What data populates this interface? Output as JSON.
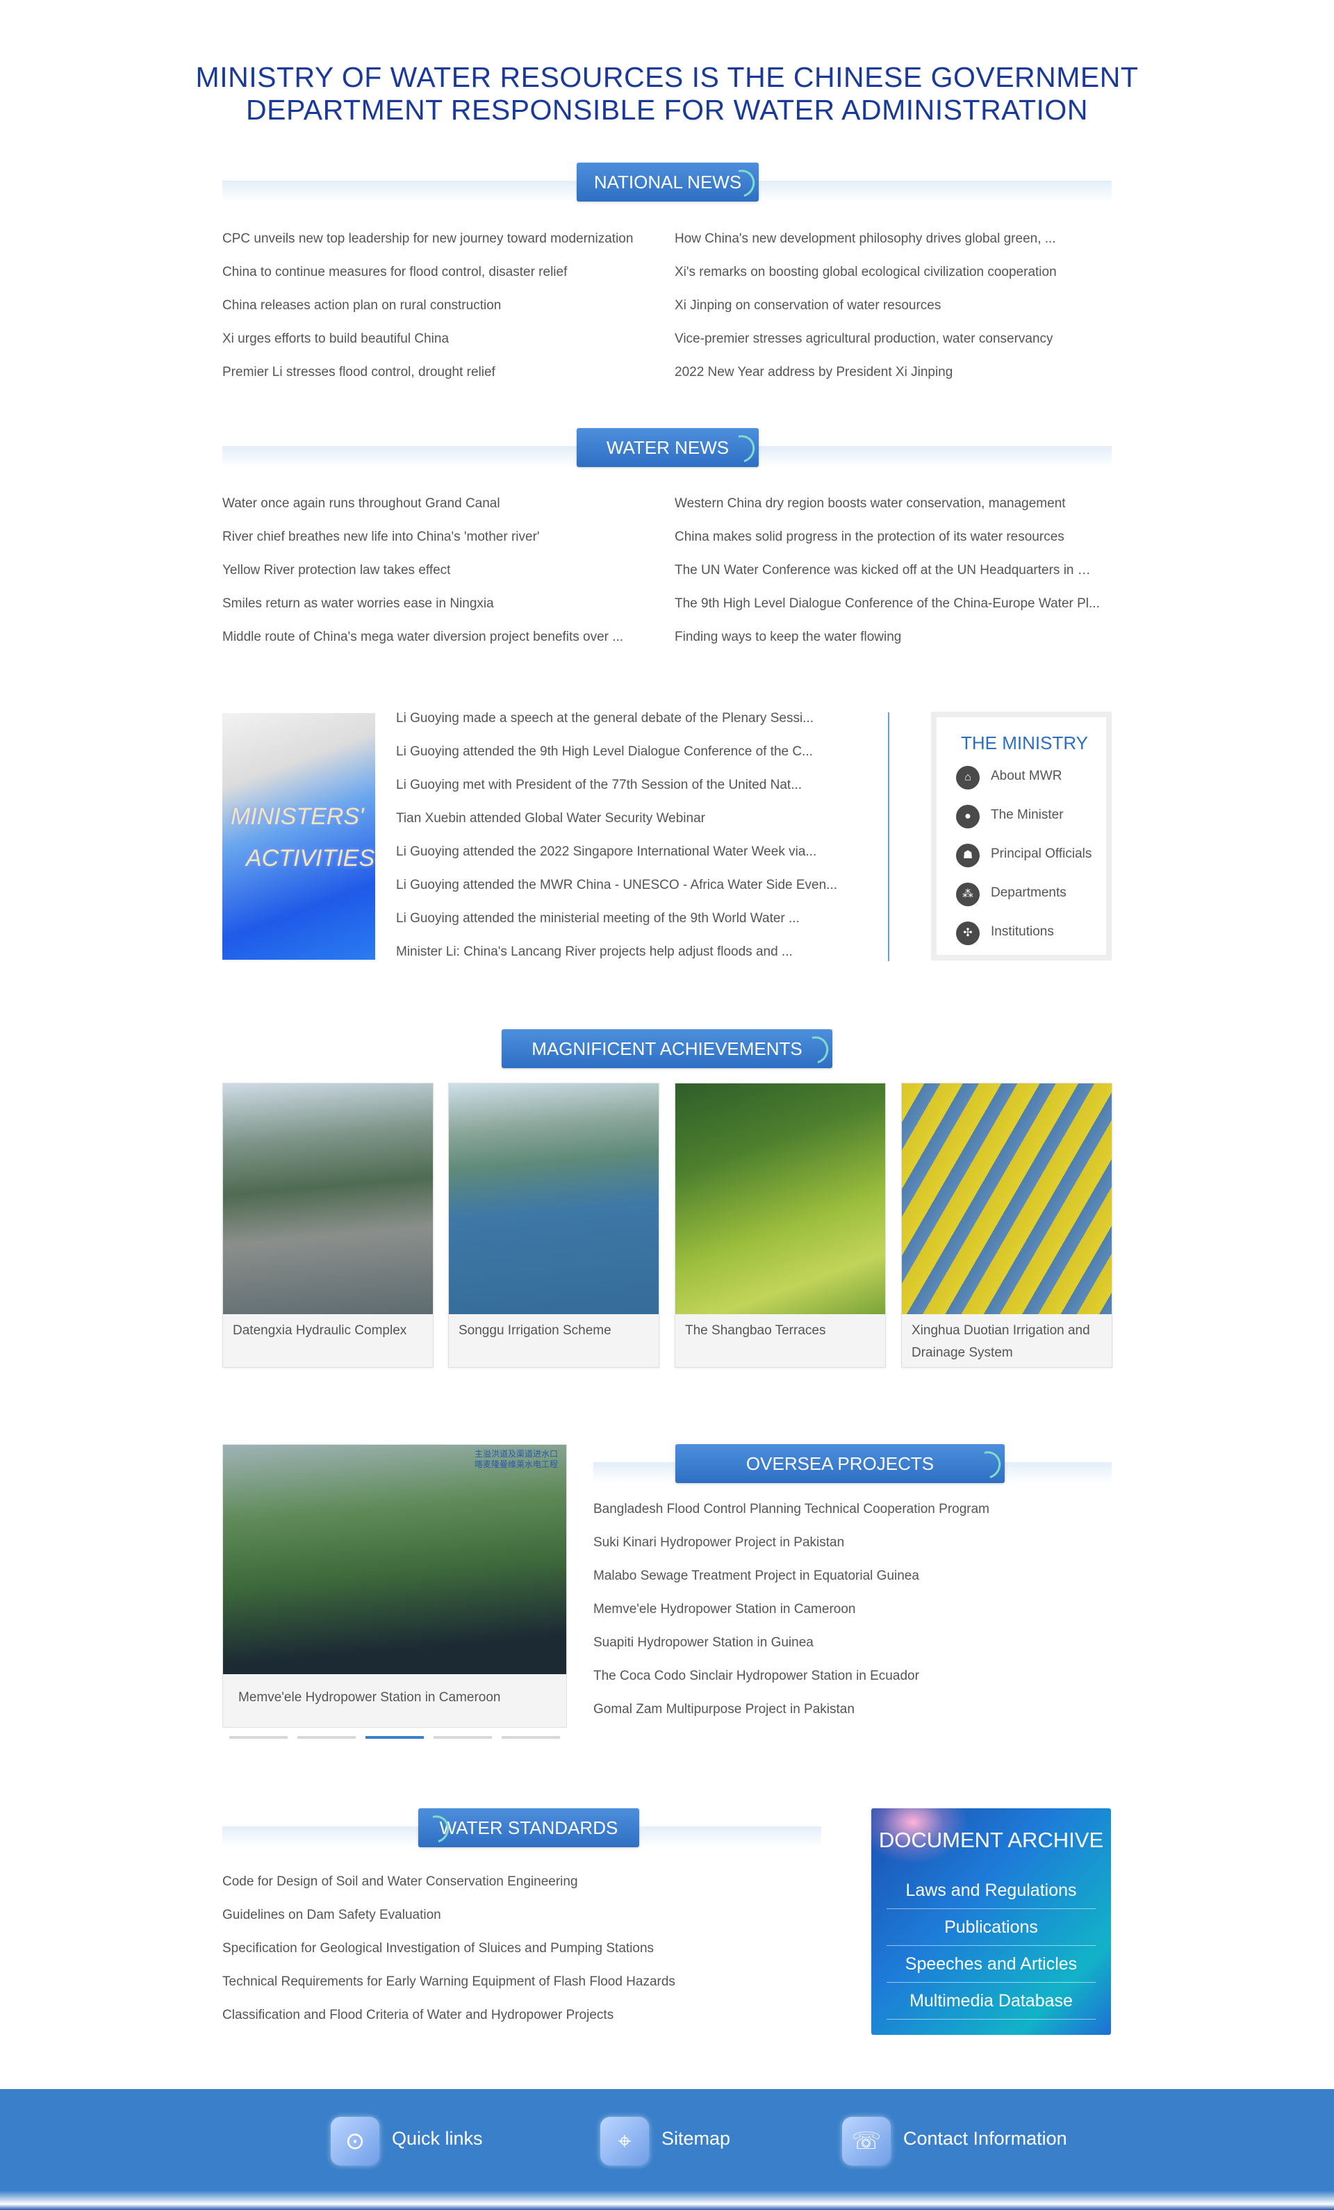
{
  "header": {
    "title_line1": "MINISTRY OF WATER RESOURCES IS THE CHINESE GOVERNMENT",
    "title_line2": "DEPARTMENT RESPONSIBLE FOR WATER ADMINISTRATION"
  },
  "national_news": {
    "label": "NATIONAL NEWS",
    "left": [
      "CPC unveils new top leadership for new journey toward modernization",
      "China to continue measures for flood control, disaster relief",
      "China releases action plan on rural construction",
      "Xi urges efforts to build beautiful China",
      "Premier Li stresses flood control, drought relief"
    ],
    "right": [
      "How China's new development philosophy drives global green, ...",
      "Xi's remarks on boosting global ecological civilization cooperation",
      "Xi Jinping on conservation of water resources",
      "Vice-premier stresses agricultural production, water conservancy",
      "2022 New Year address by President Xi Jinping"
    ]
  },
  "water_news": {
    "label": "WATER NEWS",
    "left": [
      "Water once again runs throughout Grand Canal",
      "River chief breathes new life into China's 'mother river'",
      "Yellow River protection law takes effect",
      "Smiles return as water worries ease in Ningxia",
      "Middle route of China's mega water diversion project benefits over ..."
    ],
    "right": [
      "Western China dry region boosts water conservation, management",
      "China makes solid progress in the protection of its water resources",
      "The UN Water Conference was kicked off at the UN Headquarters in Ne...",
      "The 9th High Level Dialogue Conference of the China-Europe Water Pl...",
      "Finding ways to keep the water flowing"
    ]
  },
  "ministers": {
    "image_text_1": "MINISTERS'",
    "image_text_2": "ACTIVITIES",
    "items": [
      "Li Guoying made a speech at the general debate of the Plenary Sessi...",
      "Li Guoying attended the 9th High Level Dialogue Conference of the C...",
      "Li Guoying met with President of the 77th Session of the United Nat...",
      "Tian Xuebin attended Global Water Security Webinar",
      "Li Guoying attended the 2022 Singapore International Water Week via...",
      "Li Guoying attended the MWR China - UNESCO - Africa Water Side Even...",
      "Li Guoying attended the ministerial meeting of the 9th World Water ...",
      "Minister Li: China's Lancang River projects help adjust floods and ..."
    ]
  },
  "ministry": {
    "title": "THE MINISTRY",
    "items": [
      {
        "label": "About MWR",
        "icon": "home-icon"
      },
      {
        "label": "The Minister",
        "icon": "person-icon"
      },
      {
        "label": "Principal Officials",
        "icon": "group-icon"
      },
      {
        "label": "Departments",
        "icon": "org-icon"
      },
      {
        "label": "Institutions",
        "icon": "network-icon"
      }
    ]
  },
  "achievements": {
    "label": "MAGNIFICENT ACHIEVEMENTS",
    "cards": [
      "Datengxia Hydraulic Complex",
      "Songgu Irrigation Scheme",
      "The Shangbao Terraces",
      "Xinghua Duotian Irrigation and Drainage System"
    ]
  },
  "oversea": {
    "label": "OVERSEA PROJECTS",
    "image_caption": "Memve'ele Hydropower Station in Cameroon",
    "image_tag_line1": "主溢洪道及渠道进水口",
    "image_tag_line2": "喀麦隆曼维莱水电工程",
    "active_slide": 3,
    "items": [
      "Bangladesh Flood Control Planning Technical Cooperation Program",
      "Suki Kinari Hydropower Project in Pakistan",
      "Malabo Sewage Treatment Project in Equatorial Guinea",
      "Memve'ele Hydropower Station in Cameroon",
      "Suapiti Hydropower Station in Guinea",
      "The Coca Codo Sinclair Hydropower Station in Ecuador",
      "Gomal Zam Multipurpose Project in Pakistan"
    ]
  },
  "standards": {
    "label": "WATER STANDARDS",
    "items": [
      "Code for Design of Soil and Water Conservation Engineering",
      "Guidelines on Dam Safety Evaluation",
      "Specification for Geological Investigation of Sluices and Pumping Stations",
      "Technical Requirements for Early Warning Equipment of Flash Flood Hazards",
      "Classification and Flood Criteria of Water and Hydropower Projects"
    ]
  },
  "archive": {
    "title": "DOCUMENT ARCHIVE",
    "links": [
      "Laws and Regulations",
      "Publications",
      "Speeches and Articles",
      "Multimedia Database"
    ]
  },
  "footer": {
    "items": [
      {
        "label": "Quick links",
        "icon": "link-icon"
      },
      {
        "label": "Sitemap",
        "icon": "map-pin-icon"
      },
      {
        "label": "Contact Information",
        "icon": "phone-icon"
      }
    ]
  },
  "colors": {
    "title_blue": "#1a3a9a",
    "badge_blue": "#2e6fc4",
    "footer_blue": "#3a7fc9"
  }
}
